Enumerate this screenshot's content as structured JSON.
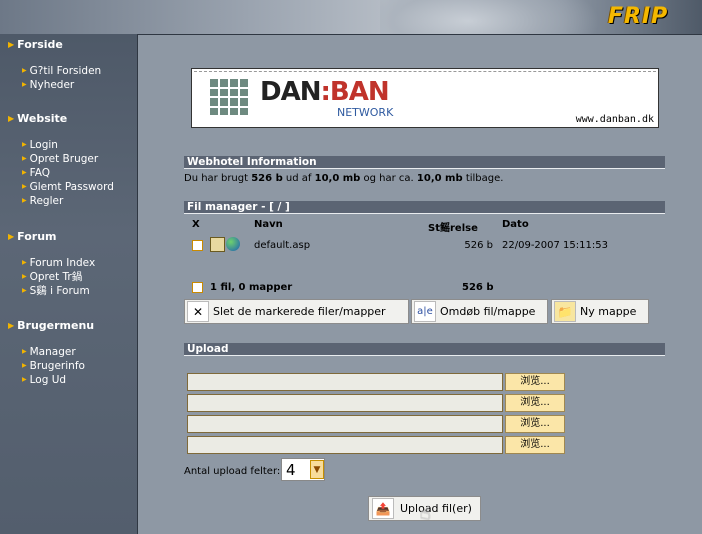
{
  "brand": {
    "logo_text": "FRIP"
  },
  "sidebar": {
    "sections": [
      {
        "title": "Forside",
        "items": [
          "G?til Forsiden",
          "Nyheder"
        ]
      },
      {
        "title": "Website",
        "items": [
          "Login",
          "Opret Bruger",
          "FAQ",
          "Glemt Password",
          "Regler"
        ]
      },
      {
        "title": "Forum",
        "items": [
          "Forum Index",
          "Opret Tr鍋",
          "S鷄 i Forum"
        ]
      },
      {
        "title": "Brugermenu",
        "items": [
          "Manager",
          "Brugerinfo",
          "Log Ud"
        ]
      }
    ]
  },
  "banner": {
    "brand_left": "DAN",
    "brand_sep": ":",
    "brand_right": "BAN",
    "subtitle": "NETWORK",
    "url": "www.danban.dk"
  },
  "webhotel": {
    "title": "Webhotel Information",
    "line_prefix": "Du har brugt ",
    "used": "526 b",
    "mid1": " ud af ",
    "total": "10,0 mb",
    "mid2": " og har ca. ",
    "remaining": "10,0 mb",
    "suffix": " tilbage."
  },
  "filemanager": {
    "title": "Fil manager - [ / ]",
    "columns": {
      "x": "X",
      "name": "Navn",
      "size": "St鳐relse",
      "date": "Dato"
    },
    "files": [
      {
        "name": "default.asp",
        "size": "526 b",
        "date": "22/09-2007 15:11:53"
      }
    ],
    "summary_label": "1 fil, 0 mapper",
    "summary_size": "526 b",
    "actions": {
      "delete": "Slet de markerede filer/mapper",
      "rename": "Omdøb fil/mappe",
      "new_folder": "Ny mappe"
    }
  },
  "upload": {
    "title": "Upload",
    "browse_label": "浏览...",
    "count_label": "Antal upload felter:",
    "count_value": "4",
    "submit_label": "Upload fil(er)"
  },
  "colors": {
    "accent": "#f2b400",
    "section_bar": "#5b6473",
    "main_bg": "#8e98a4"
  }
}
